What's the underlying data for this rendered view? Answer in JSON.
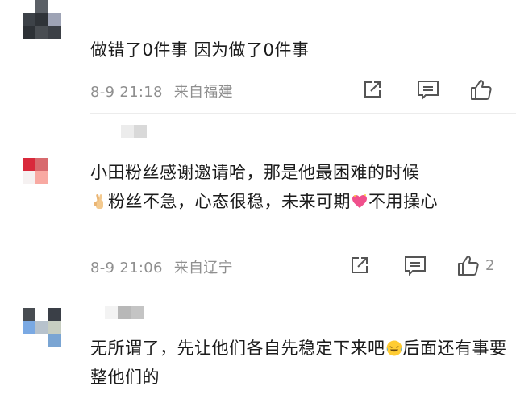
{
  "comments": [
    {
      "text": "做错了0件事 因为做了0件事",
      "date": "8-9 21:18",
      "location": "来自福建",
      "like_count": ""
    },
    {
      "text_parts": [
        "小田粉丝感谢邀请哈，那是他最困难的时候",
        "粉丝不急，心态很稳，未来可期",
        "不用操心"
      ],
      "date": "8-9 21:06",
      "location": "来自辽宁",
      "like_count": "2"
    },
    {
      "text_parts": [
        "无所谓了，先让他们各自先稳定下来吧",
        "后面还有事要整他们的"
      ]
    }
  ],
  "icons": {
    "repost": "repost-icon",
    "comment": "comment-icon",
    "like": "thumbs-up-icon",
    "emoji_fingers": "crossed-fingers-emoji",
    "emoji_heart": "sparkling-heart-emoji",
    "emoji_laugh": "laughing-crying-emoji"
  },
  "colors": {
    "text": "#1b1b1b",
    "meta": "#8f8f8f",
    "divider": "#ececec"
  }
}
